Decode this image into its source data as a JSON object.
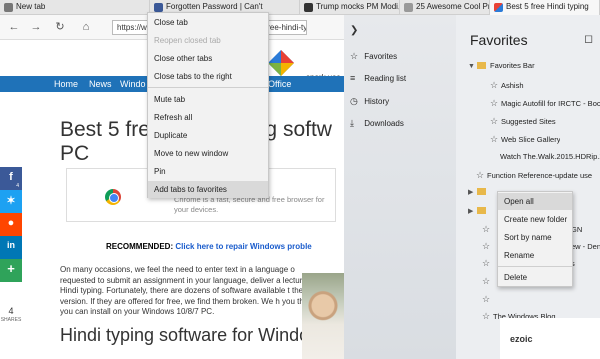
{
  "tabs": [
    {
      "label": "New tab",
      "color": "#555555"
    },
    {
      "label": "Forgotten Password | Can't",
      "color": "#3b5998"
    },
    {
      "label": "Trump mocks PM Modi, say",
      "color": "#333333"
    },
    {
      "label": "25 Awesome Cool Products",
      "color": "#888888"
    },
    {
      "label": "Best 5 free Hindi typing",
      "color": "#2b7bd8"
    }
  ],
  "toolbar": {
    "back_icon": "back-arrow-icon",
    "forward_icon": "forward-arrow-icon",
    "refresh_icon": "refresh-icon",
    "home_icon": "home-icon",
    "url_prefix": "https://w",
    "url_suffix": "st-5-free-hindi-typin"
  },
  "tab_context_menu": [
    {
      "label": "Close tab",
      "enabled": true
    },
    {
      "label": "Reopen closed tab",
      "enabled": false
    },
    {
      "label": "Close other tabs",
      "enabled": true
    },
    {
      "label": "Close tabs to the right",
      "enabled": true
    },
    {
      "label": "Mute tab",
      "enabled": true
    },
    {
      "label": "Refresh all",
      "enabled": true
    },
    {
      "label": "Duplicate",
      "enabled": true
    },
    {
      "label": "Move to new window",
      "enabled": true
    },
    {
      "label": "Pin",
      "enabled": true
    },
    {
      "label": "Add tabs to favorites",
      "enabled": true
    }
  ],
  "page": {
    "spark_text": "spark  use",
    "nav": [
      "Home",
      "News",
      "Windo",
      "ty",
      "Office"
    ],
    "title": "Best 5 free Hindi typing softw PC",
    "title_line1": "Best 5 free Hindi typing softw",
    "title_line2": "PC",
    "ad_text": "Chrome is a fast, secure and free browser for your devices.",
    "recommended_label": "RECOMMENDED:",
    "recommended_link": "Click here to repair Windows proble",
    "paragraph": "On many occasions, we feel the need to enter text in a language o requested to submit an assignment in your language, deliver a lecture for Hindi typing. Fortunately, there are dozens of software available t the full version. If they are offered for free, we find them broken. We h you that you can install on your Windows 10/8/7 PC.",
    "subtitle": "Hindi typing software for Windows 10"
  },
  "social": [
    {
      "icon": "facebook-icon",
      "glyph": "f",
      "count": "4",
      "color": "#3b5998"
    },
    {
      "icon": "twitter-icon",
      "glyph": "✶",
      "count": "",
      "color": "#1da1f2"
    },
    {
      "icon": "reddit-icon",
      "glyph": "●",
      "count": "",
      "color": "#ff4500"
    },
    {
      "icon": "linkedin-icon",
      "glyph": "in",
      "count": "",
      "color": "#0077b5"
    },
    {
      "icon": "plus-icon",
      "glyph": "+",
      "count": "",
      "color": "#2fa35a"
    }
  ],
  "shares": {
    "count": "4",
    "label": "SHARES"
  },
  "hub": {
    "items": [
      {
        "label": "Favorites",
        "icon": "star-icon",
        "glyph": "☆"
      },
      {
        "label": "Reading list",
        "icon": "reading-list-icon",
        "glyph": "≡"
      },
      {
        "label": "History",
        "icon": "history-icon",
        "glyph": "◷"
      },
      {
        "label": "Downloads",
        "icon": "download-icon",
        "glyph": "⤓"
      }
    ]
  },
  "favorites": {
    "title": "Favorites",
    "rows": [
      {
        "kind": "folder",
        "label": "Favorites Bar",
        "expanded": true
      },
      {
        "kind": "star",
        "label": "Ashish"
      },
      {
        "kind": "star",
        "label": "Magic Autofill for IRCTC - Boo"
      },
      {
        "kind": "star",
        "label": "Suggested Sites"
      },
      {
        "kind": "star",
        "label": "Web Slice Gallery"
      },
      {
        "kind": "plain",
        "label": "Watch The.Walk.2015.HDRip.Xv"
      },
      {
        "kind": "star",
        "label": "Function Reference-update use"
      },
      {
        "kind": "folder",
        "label": ""
      },
      {
        "kind": "folder",
        "label": ""
      },
      {
        "kind": "star",
        "label": "GN"
      },
      {
        "kind": "star",
        "label": "ew - Den"
      },
      {
        "kind": "star",
        "label": "s"
      },
      {
        "kind": "star",
        "label": ""
      },
      {
        "kind": "star",
        "label": ""
      },
      {
        "kind": "star",
        "label": "The Windows Blog"
      }
    ]
  },
  "fav_context_menu": [
    {
      "label": "Open all"
    },
    {
      "label": "Create new folder"
    },
    {
      "label": "Sort by name"
    },
    {
      "label": "Rename"
    },
    {
      "label": "Delete"
    }
  ],
  "ezoic": {
    "label": "ezoic"
  }
}
